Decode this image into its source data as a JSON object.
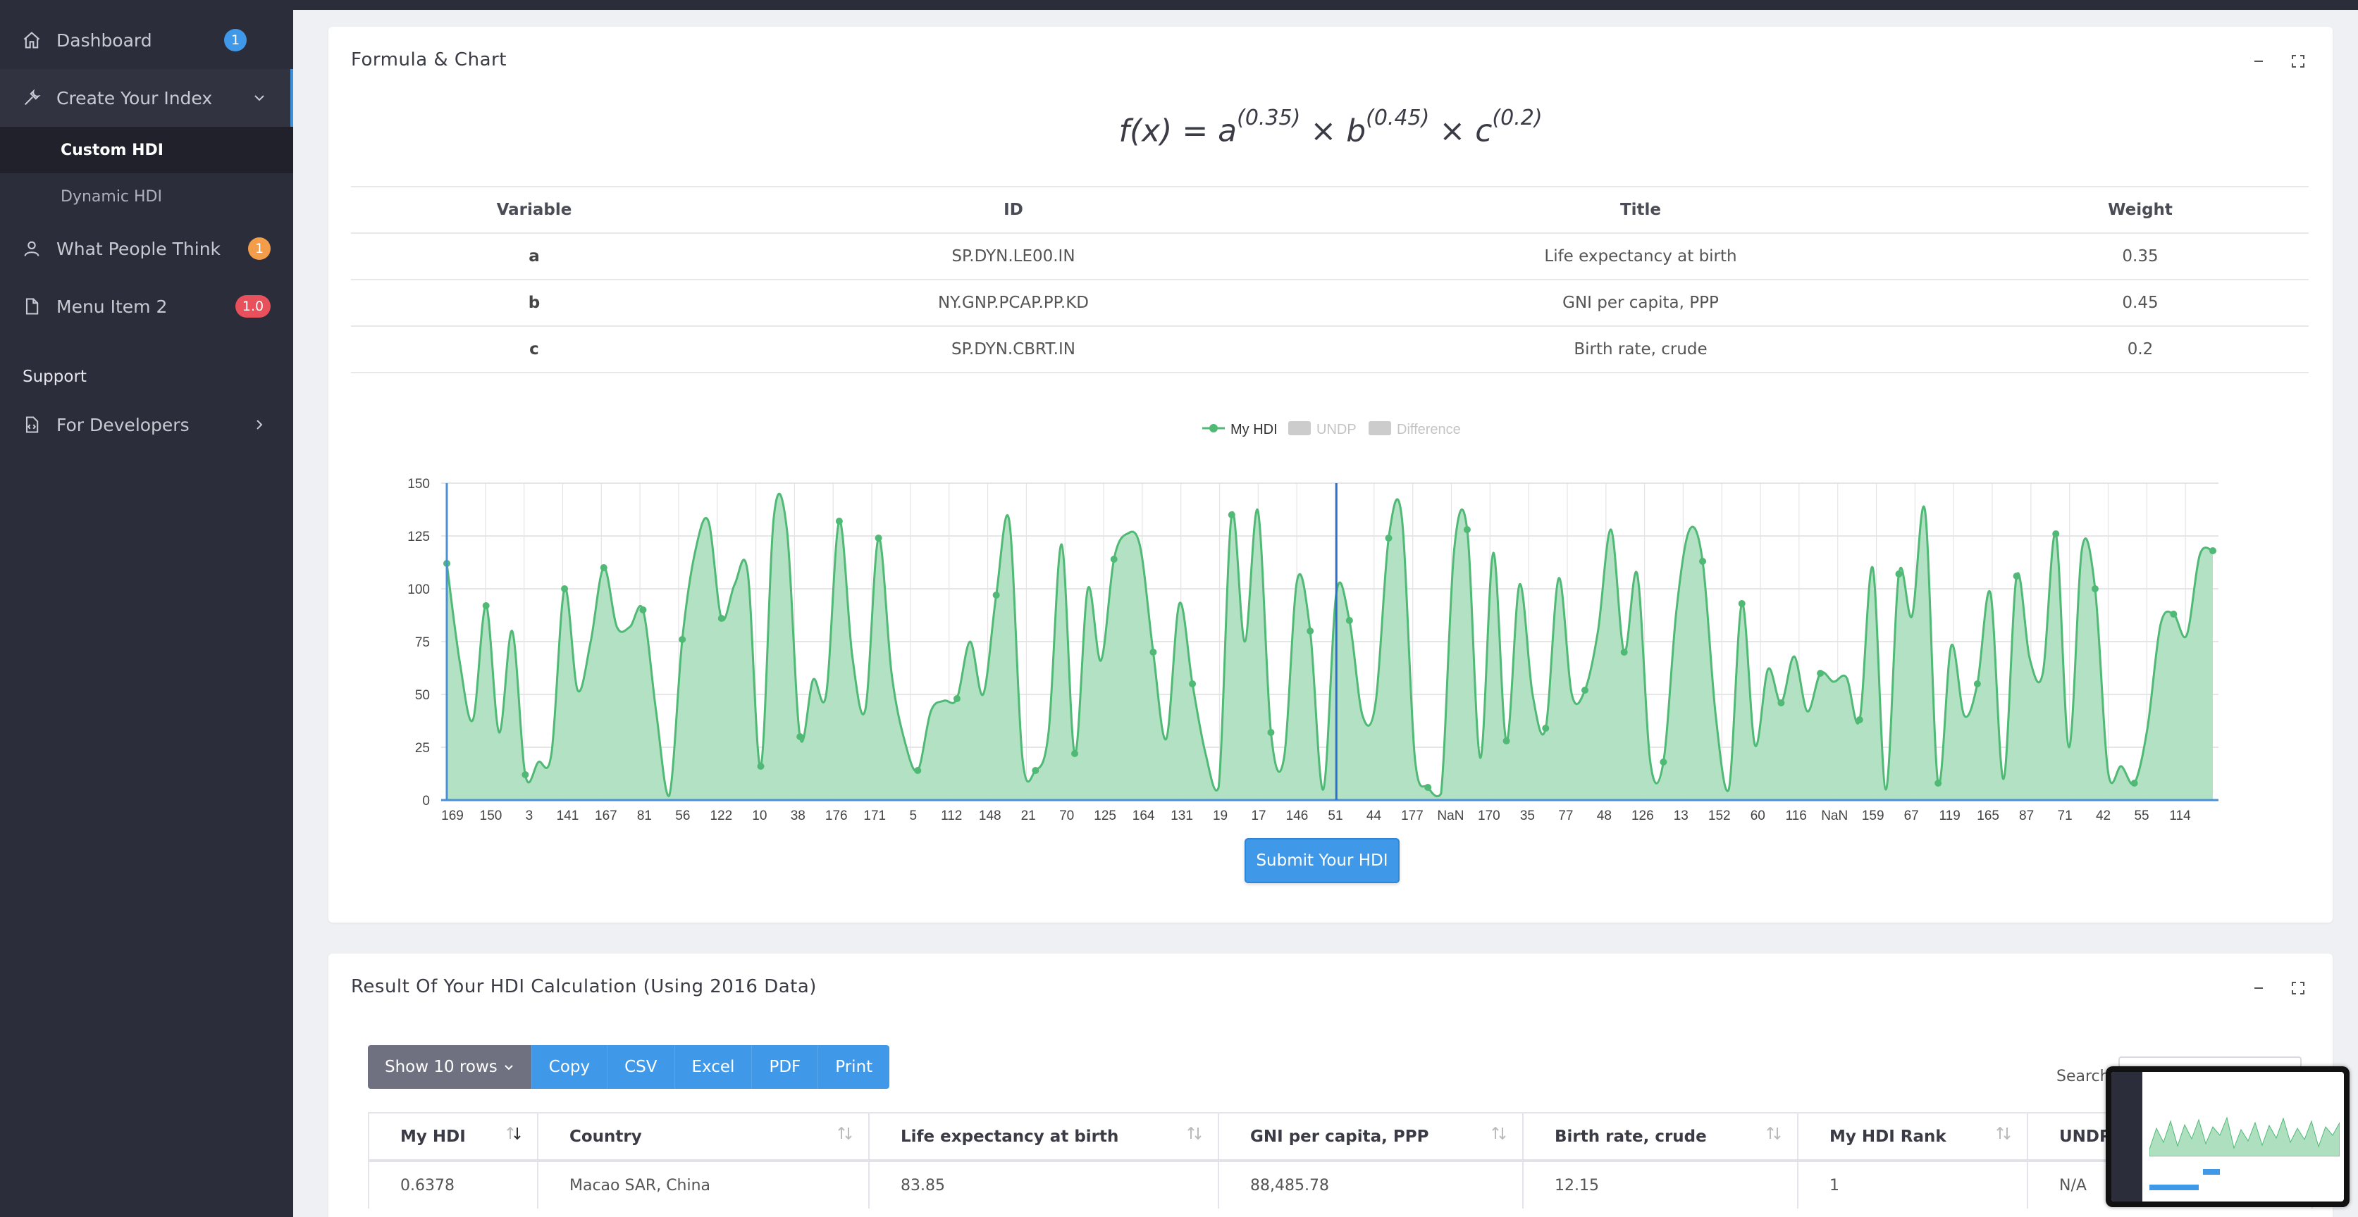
{
  "sidebar": {
    "items": [
      {
        "label": "Dashboard",
        "icon": "home-icon",
        "badge": "1",
        "badge_color": "#3f99e8"
      },
      {
        "label": "Create Your Index",
        "icon": "tools-icon"
      },
      {
        "label": "What People Think",
        "icon": "user-icon",
        "badge": "1",
        "badge_color": "#f39c4a"
      },
      {
        "label": "Menu Item 2",
        "icon": "file-icon",
        "badge": "1.0",
        "badge_color": "#e8505b"
      }
    ],
    "subitems": [
      "Custom HDI",
      "Dynamic HDI"
    ],
    "support_heading": "Support",
    "developers": {
      "label": "For Developers",
      "icon": "code-file-icon"
    }
  },
  "formula_card": {
    "title": "Formula & Chart",
    "formula": {
      "a": "a",
      "b": "b",
      "c": "c",
      "fx": "f(x) = ",
      "times": " × ",
      "ea": "(0.35)",
      "eb": "(0.45)",
      "ec": "(0.2)"
    },
    "variables": {
      "headers": [
        "Variable",
        "ID",
        "Title",
        "Weight"
      ],
      "rows": [
        [
          "a",
          "SP.DYN.LE00.IN",
          "Life expectancy at birth",
          "0.35"
        ],
        [
          "b",
          "NY.GNP.PCAP.PP.KD",
          "GNI per capita, PPP",
          "0.45"
        ],
        [
          "c",
          "SP.DYN.CBRT.IN",
          "Birth rate, crude",
          "0.2"
        ]
      ]
    },
    "submit_label": "Submit Your HDI"
  },
  "chart_data": {
    "type": "area",
    "legend": [
      "My HDI",
      "UNDP",
      "Difference"
    ],
    "legend_placement": "top-center",
    "colors": {
      "line": "#4fb975",
      "fill": "#aee0c0",
      "hidden": "#cccccc",
      "axis": "#4a90d9"
    },
    "ylim": [
      0,
      150
    ],
    "yticks": [
      0,
      25,
      50,
      75,
      100,
      125,
      150
    ],
    "grid": true,
    "xtick_labels": [
      "169",
      "150",
      "3",
      "141",
      "167",
      "81",
      "56",
      "122",
      "10",
      "38",
      "176",
      "171",
      "5",
      "112",
      "148",
      "21",
      "70",
      "125",
      "164",
      "131",
      "19",
      "17",
      "146",
      "51",
      "44",
      "177",
      "NaN",
      "170",
      "35",
      "77",
      "48",
      "126",
      "13",
      "152",
      "60",
      "116",
      "NaN",
      "159",
      "67",
      "119",
      "165",
      "87",
      "71",
      "42",
      "55",
      "114"
    ],
    "values": [
      112,
      65,
      38,
      92,
      32,
      80,
      12,
      18,
      22,
      100,
      52,
      75,
      110,
      82,
      82,
      90,
      42,
      2,
      76,
      118,
      132,
      86,
      102,
      108,
      16,
      134,
      128,
      30,
      57,
      50,
      132,
      68,
      43,
      124,
      60,
      28,
      14,
      42,
      47,
      48,
      75,
      50,
      97,
      132,
      20,
      14,
      32,
      121,
      22,
      100,
      66,
      114,
      126,
      120,
      70,
      29,
      93,
      55,
      22,
      6,
      135,
      75,
      137,
      32,
      20,
      104,
      80,
      5,
      98,
      85,
      40,
      46,
      124,
      134,
      20,
      6,
      3,
      118,
      128,
      20,
      117,
      28,
      102,
      50,
      34,
      105,
      50,
      52,
      80,
      128,
      70,
      107,
      18,
      18,
      90,
      128,
      113,
      40,
      5,
      93,
      26,
      62,
      46,
      68,
      42,
      60,
      56,
      58,
      38,
      110,
      5,
      107,
      87,
      137,
      8,
      73,
      40,
      55,
      98,
      10,
      106,
      67,
      60,
      126,
      25,
      119,
      100,
      13,
      16,
      8,
      34,
      83,
      88,
      78,
      116,
      118
    ]
  },
  "result_card": {
    "title": "Result Of Your HDI Calculation (Using 2016 Data)",
    "toolbar": [
      "Show 10 rows",
      "Copy",
      "CSV",
      "Excel",
      "PDF",
      "Print"
    ],
    "search_label": "Search:",
    "headers": [
      "My HDI",
      "Country",
      "Life expectancy at birth",
      "GNI per capita, PPP",
      "Birth rate, crude",
      "My HDI Rank",
      "UNDP"
    ],
    "rows": [
      [
        "0.6378",
        "Macao SAR, China",
        "83.85",
        "88,485.78",
        "12.15",
        "1",
        "N/A"
      ]
    ]
  }
}
